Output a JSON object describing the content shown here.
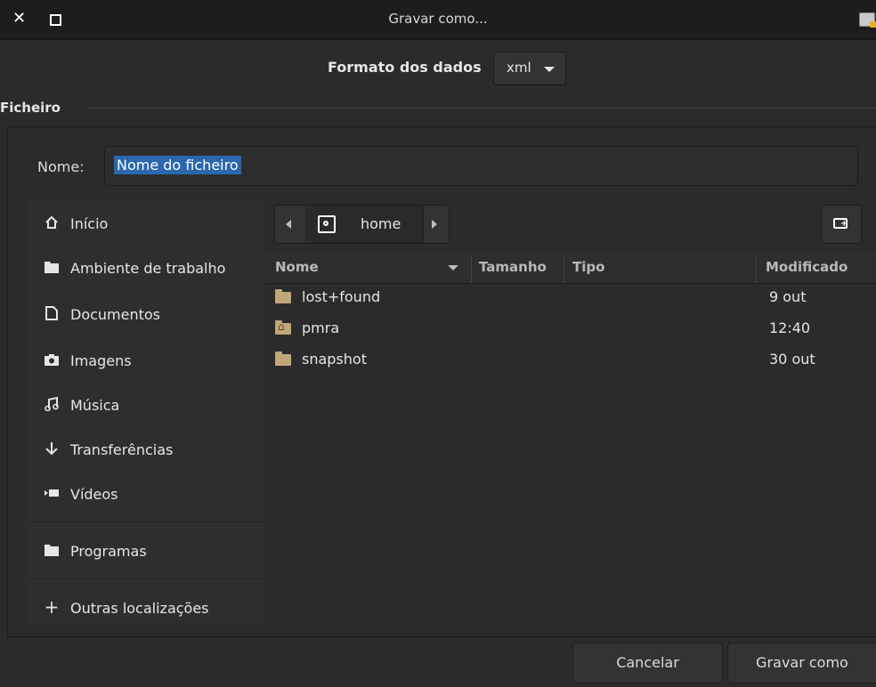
{
  "window": {
    "title": "Gravar como..."
  },
  "format": {
    "label": "Formato dos dados",
    "value": "xml"
  },
  "section": {
    "label": "Ficheiro"
  },
  "name": {
    "label": "Nome:",
    "value": "Nome do ficheiro"
  },
  "sidebar": {
    "items": [
      {
        "label": "Início",
        "icon": "home-icon"
      },
      {
        "label": "Ambiente de trabalho",
        "icon": "folder-icon"
      },
      {
        "label": "Documentos",
        "icon": "document-icon"
      },
      {
        "label": "Imagens",
        "icon": "camera-icon"
      },
      {
        "label": "Música",
        "icon": "music-icon"
      },
      {
        "label": "Transferências",
        "icon": "download-icon"
      },
      {
        "label": "Vídeos",
        "icon": "video-icon"
      },
      {
        "label": "Programas",
        "icon": "folder-icon"
      },
      {
        "label": "Outras localizações",
        "icon": "plus-icon"
      }
    ]
  },
  "pathbar": {
    "current": "home"
  },
  "table": {
    "columns": [
      "Nome",
      "Tamanho",
      "Tipo",
      "Modificado"
    ],
    "rows": [
      {
        "name": "lost+found",
        "modified": "9 out",
        "icon": "folder-icon"
      },
      {
        "name": "pmra",
        "modified": "12:40",
        "icon": "home-folder-icon"
      },
      {
        "name": "snapshot",
        "modified": "30 out",
        "icon": "folder-icon"
      }
    ]
  },
  "buttons": {
    "cancel": "Cancelar",
    "save": "Gravar como"
  }
}
